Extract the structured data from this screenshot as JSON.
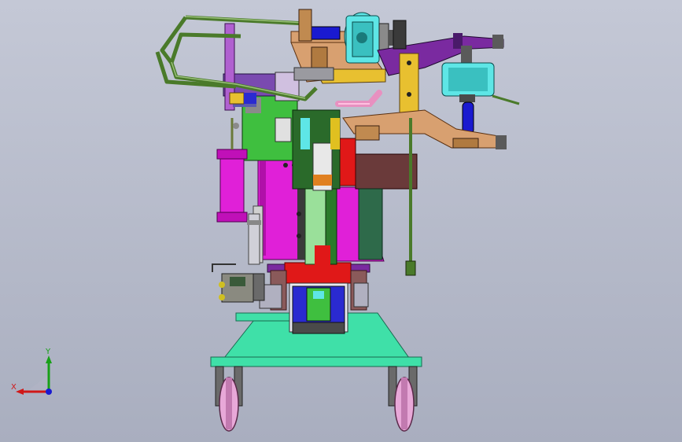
{
  "viewport": {
    "background_top": "#c4c8d6",
    "background_bottom": "#a9aebf"
  },
  "triad": {
    "x_label": "X",
    "y_label": "Y",
    "x_color": "#d01818",
    "y_color": "#18a018",
    "z_color": "#1a1ad0"
  },
  "model": {
    "description_icon": "cad-assembly-fixture-cart",
    "palette": {
      "base": "#3fe0a8",
      "body_magenta": "#e020d8",
      "frame_green": "#3fbf3f",
      "red": "#e01818",
      "cyan": "#5ee6e6",
      "tan": "#d8a070",
      "yellow": "#e8c030",
      "purple": "#7a2aa0",
      "olive": "#5a7a3a",
      "dark": "#303030",
      "wheel_pink": "#e8a8d8",
      "steel": "#8a8a8a",
      "brown": "#6a3a3a"
    }
  }
}
